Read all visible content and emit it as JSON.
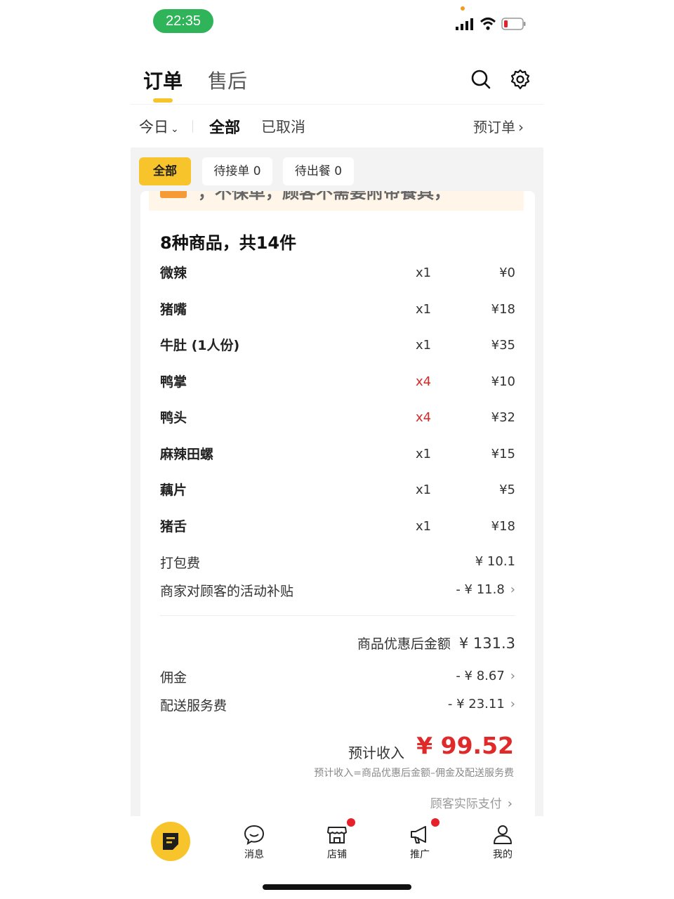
{
  "status_bar": {
    "time": "22:35"
  },
  "header": {
    "tab_orders": "订单",
    "tab_after_sales": "售后",
    "accent_color": "#f7c52b"
  },
  "filter": {
    "day": "今日",
    "all": "全部",
    "cancelled": "已取消",
    "preorder": "预订单"
  },
  "chips": [
    {
      "label": "全部"
    },
    {
      "label": "待接单 0"
    },
    {
      "label": "待出餐 0"
    }
  ],
  "notice": {
    "text": "，不保单，顾客不需要附带餐具，"
  },
  "order": {
    "summary": "8种商品，共14件",
    "items": [
      {
        "name": "微辣",
        "qty": "x1",
        "price": "¥0"
      },
      {
        "name": "猪嘴",
        "qty": "x1",
        "price": "¥18"
      },
      {
        "name": "牛肚 (1人份)",
        "qty": "x1",
        "price": "¥35"
      },
      {
        "name": "鸭掌",
        "qty": "x4",
        "price": "¥10"
      },
      {
        "name": "鸭头",
        "qty": "x4",
        "price": "¥32"
      },
      {
        "name": "麻辣田螺",
        "qty": "x1",
        "price": "¥15"
      },
      {
        "name": "藕片",
        "qty": "x1",
        "price": "¥5"
      },
      {
        "name": "猪舌",
        "qty": "x1",
        "price": "¥18"
      }
    ],
    "packing_fee": {
      "label": "打包费",
      "value": "¥ 10.1"
    },
    "subsidy": {
      "label": "商家对顾客的活动补贴",
      "value": "- ¥ 11.8"
    },
    "after_discount": {
      "label": "商品优惠后金额",
      "value": "¥ 131.3"
    },
    "commission": {
      "label": "佣金",
      "value": "- ¥ 8.67"
    },
    "delivery_fee": {
      "label": "配送服务费",
      "value": "- ¥ 23.11"
    },
    "income": {
      "label": "预计收入",
      "value": "¥ 99.52"
    },
    "formula": "预计收入=商品优惠后金额–佣金及配送服务费",
    "actual_pay": "顾客实际支付"
  },
  "bottom_nav": {
    "messages": "消息",
    "store": "店铺",
    "promote": "推广",
    "mine": "我的"
  }
}
